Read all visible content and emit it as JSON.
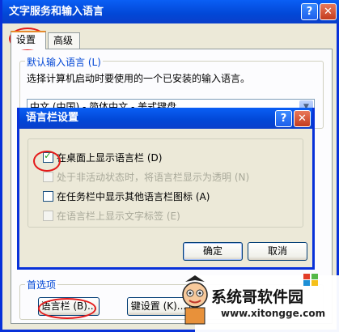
{
  "main_window": {
    "title": "文字服务和输入语言",
    "help_label": "?",
    "close_label": "✕",
    "tabs": [
      "设置",
      "高级"
    ],
    "default_group_label": "默认输入语言 (L)",
    "default_desc": "选择计算机启动时要使用的一个已安装的输入语言。",
    "default_combo_value": "中文 (中国) - 简体中文 - 美式键盘",
    "prefs_group_label": "首选项",
    "langbar_button": "语言栏 (B)...",
    "keysettings_button": "键设置 (K)..."
  },
  "dialog": {
    "title": "语言栏设置",
    "help_label": "?",
    "close_label": "✕",
    "options": [
      {
        "label": "在桌面上显示语言栏 (D)",
        "checked": true,
        "disabled": false
      },
      {
        "label": "处于非活动状态时，将语言栏显示为透明 (N)",
        "checked": false,
        "disabled": true
      },
      {
        "label": "在任务栏中显示其他语言栏图标 (A)",
        "checked": false,
        "disabled": false
      },
      {
        "label": "在语言栏上显示文字标签 (E)",
        "checked": false,
        "disabled": true
      }
    ],
    "ok_button": "确定",
    "cancel_button": "取消"
  },
  "watermark": {
    "title": "系统哥软件园",
    "url": "www.xitongge.com"
  },
  "colors": {
    "titlebar": "#0A5FF5",
    "annotation": "#E41A1A"
  }
}
